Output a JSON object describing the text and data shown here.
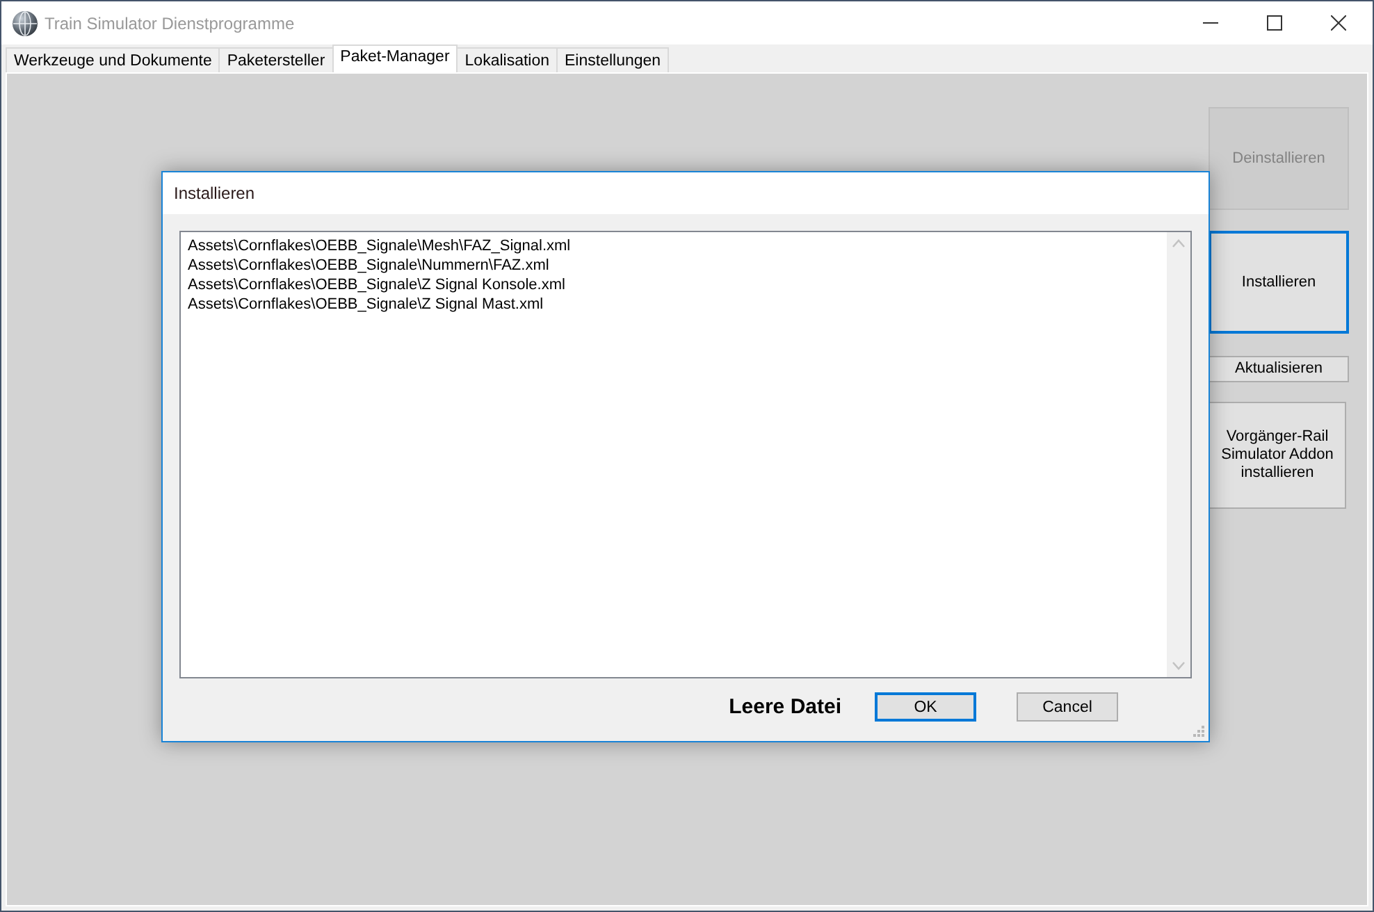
{
  "window": {
    "title": "Train Simulator Dienstprogramme"
  },
  "tabs": [
    {
      "label": "Werkzeuge und Dokumente",
      "selected": false
    },
    {
      "label": "Paketersteller",
      "selected": false
    },
    {
      "label": "Paket-Manager",
      "selected": true
    },
    {
      "label": "Lokalisation",
      "selected": false
    },
    {
      "label": "Einstellungen",
      "selected": false
    }
  ],
  "side_buttons": [
    {
      "label": "Deinstallieren",
      "disabled": true,
      "focused": false
    },
    {
      "label": "Installieren",
      "disabled": false,
      "focused": true
    },
    {
      "label": "Aktualisieren",
      "disabled": false,
      "focused": false
    },
    {
      "label": "Vorgänger-Rail Simulator Addon installieren",
      "disabled": false,
      "focused": false
    }
  ],
  "dialog": {
    "title": "Installieren",
    "files": [
      "Assets\\Cornflakes\\OEBB_Signale\\Mesh\\FAZ_Signal.xml",
      "Assets\\Cornflakes\\OEBB_Signale\\Nummern\\FAZ.xml",
      "Assets\\Cornflakes\\OEBB_Signale\\Z Signal Konsole.xml",
      "Assets\\Cornflakes\\OEBB_Signale\\Z Signal Mast.xml"
    ],
    "status": "Leere Datei",
    "buttons": [
      {
        "label": "OK",
        "focused": true
      },
      {
        "label": "Cancel",
        "focused": false
      }
    ]
  }
}
